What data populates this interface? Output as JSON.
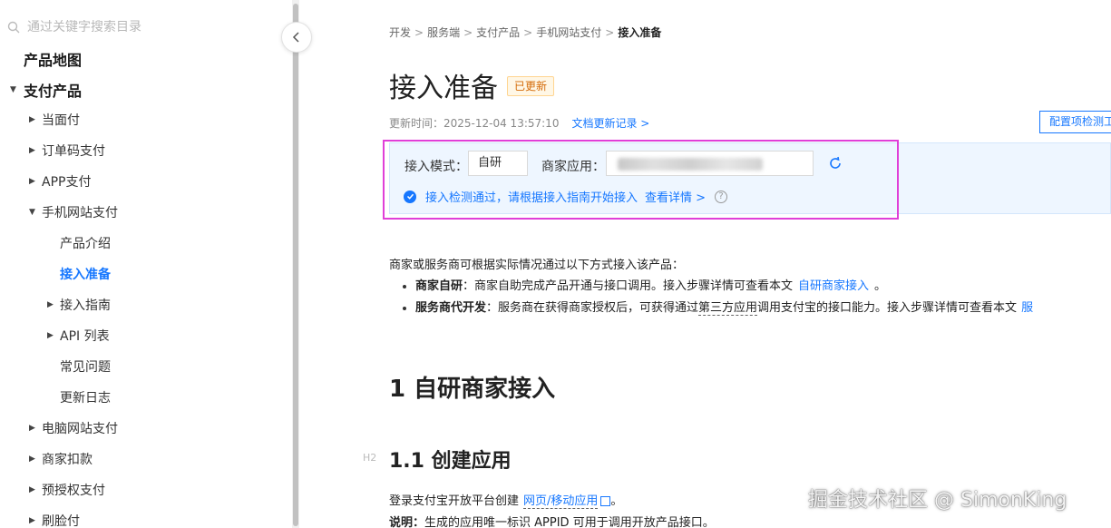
{
  "sidebar": {
    "search_placeholder": "通过关键字搜索目录",
    "items": [
      {
        "label": "产品地图",
        "level": 0
      },
      {
        "label": "支付产品",
        "level": 0,
        "expanded": true
      },
      {
        "label": "当面付",
        "level": 1
      },
      {
        "label": "订单码支付",
        "level": 1
      },
      {
        "label": "APP支付",
        "level": 1
      },
      {
        "label": "手机网站支付",
        "level": 1,
        "expanded": true
      },
      {
        "label": "产品介绍",
        "level": 2
      },
      {
        "label": "接入准备",
        "level": 2,
        "active": true
      },
      {
        "label": "接入指南",
        "level": 2
      },
      {
        "label": "API 列表",
        "level": 2
      },
      {
        "label": "常见问题",
        "level": 2
      },
      {
        "label": "更新日志",
        "level": 2
      },
      {
        "label": "电脑网站支付",
        "level": 1
      },
      {
        "label": "商家扣款",
        "level": 1
      },
      {
        "label": "预授权支付",
        "level": 1
      },
      {
        "label": "刷脸付",
        "level": 1
      }
    ]
  },
  "breadcrumb": [
    "开发",
    "服务端",
    "支付产品",
    "手机网站支付",
    "接入准备"
  ],
  "page": {
    "title": "接入准备",
    "badge": "已更新",
    "updated_time": "更新时间：2025-12-04 13:57:10",
    "changelog_link": "文档更新记录 >",
    "config_button": "配置项检测工"
  },
  "check": {
    "mode_label": "接入模式：",
    "mode_value": "自研",
    "app_label": "商家应用：",
    "pass_text": "接入检测通过，请根据接入指南开始接入",
    "details_link": "查看详情 >",
    "help_icon": "?"
  },
  "content": {
    "intro": "商家或服务商可根据实际情况通过以下方式接入该产品：",
    "b1_strong": "商家自研",
    "b1_text": "：商家自助完成产品开通与接口调用。接入步骤详情可查看本文",
    "b1_link": "自研商家接入",
    "b1_end": "。",
    "b2_strong": "服务商代开发",
    "b2_text_a": "：服务商在获得商家授权后，可获得通过",
    "b2_dashed": "第三方应用",
    "b2_text_b": "调用支付宝的接口能力。接入步骤详情可查看本文",
    "b2_link": "服",
    "h1": "1 自研商家接入",
    "h2_tag": "H2",
    "h2": "1.1 创建应用",
    "p1_text": "登录支付宝开放平台创建",
    "p1_link": "网页/移动应用",
    "p1_end": "。",
    "p2_strong": "说明：",
    "p2_text": "生成的应用唯一标识 APPID 可用于调用开放产品接口。"
  },
  "watermark": "掘金技术社区 @ SimonKing"
}
